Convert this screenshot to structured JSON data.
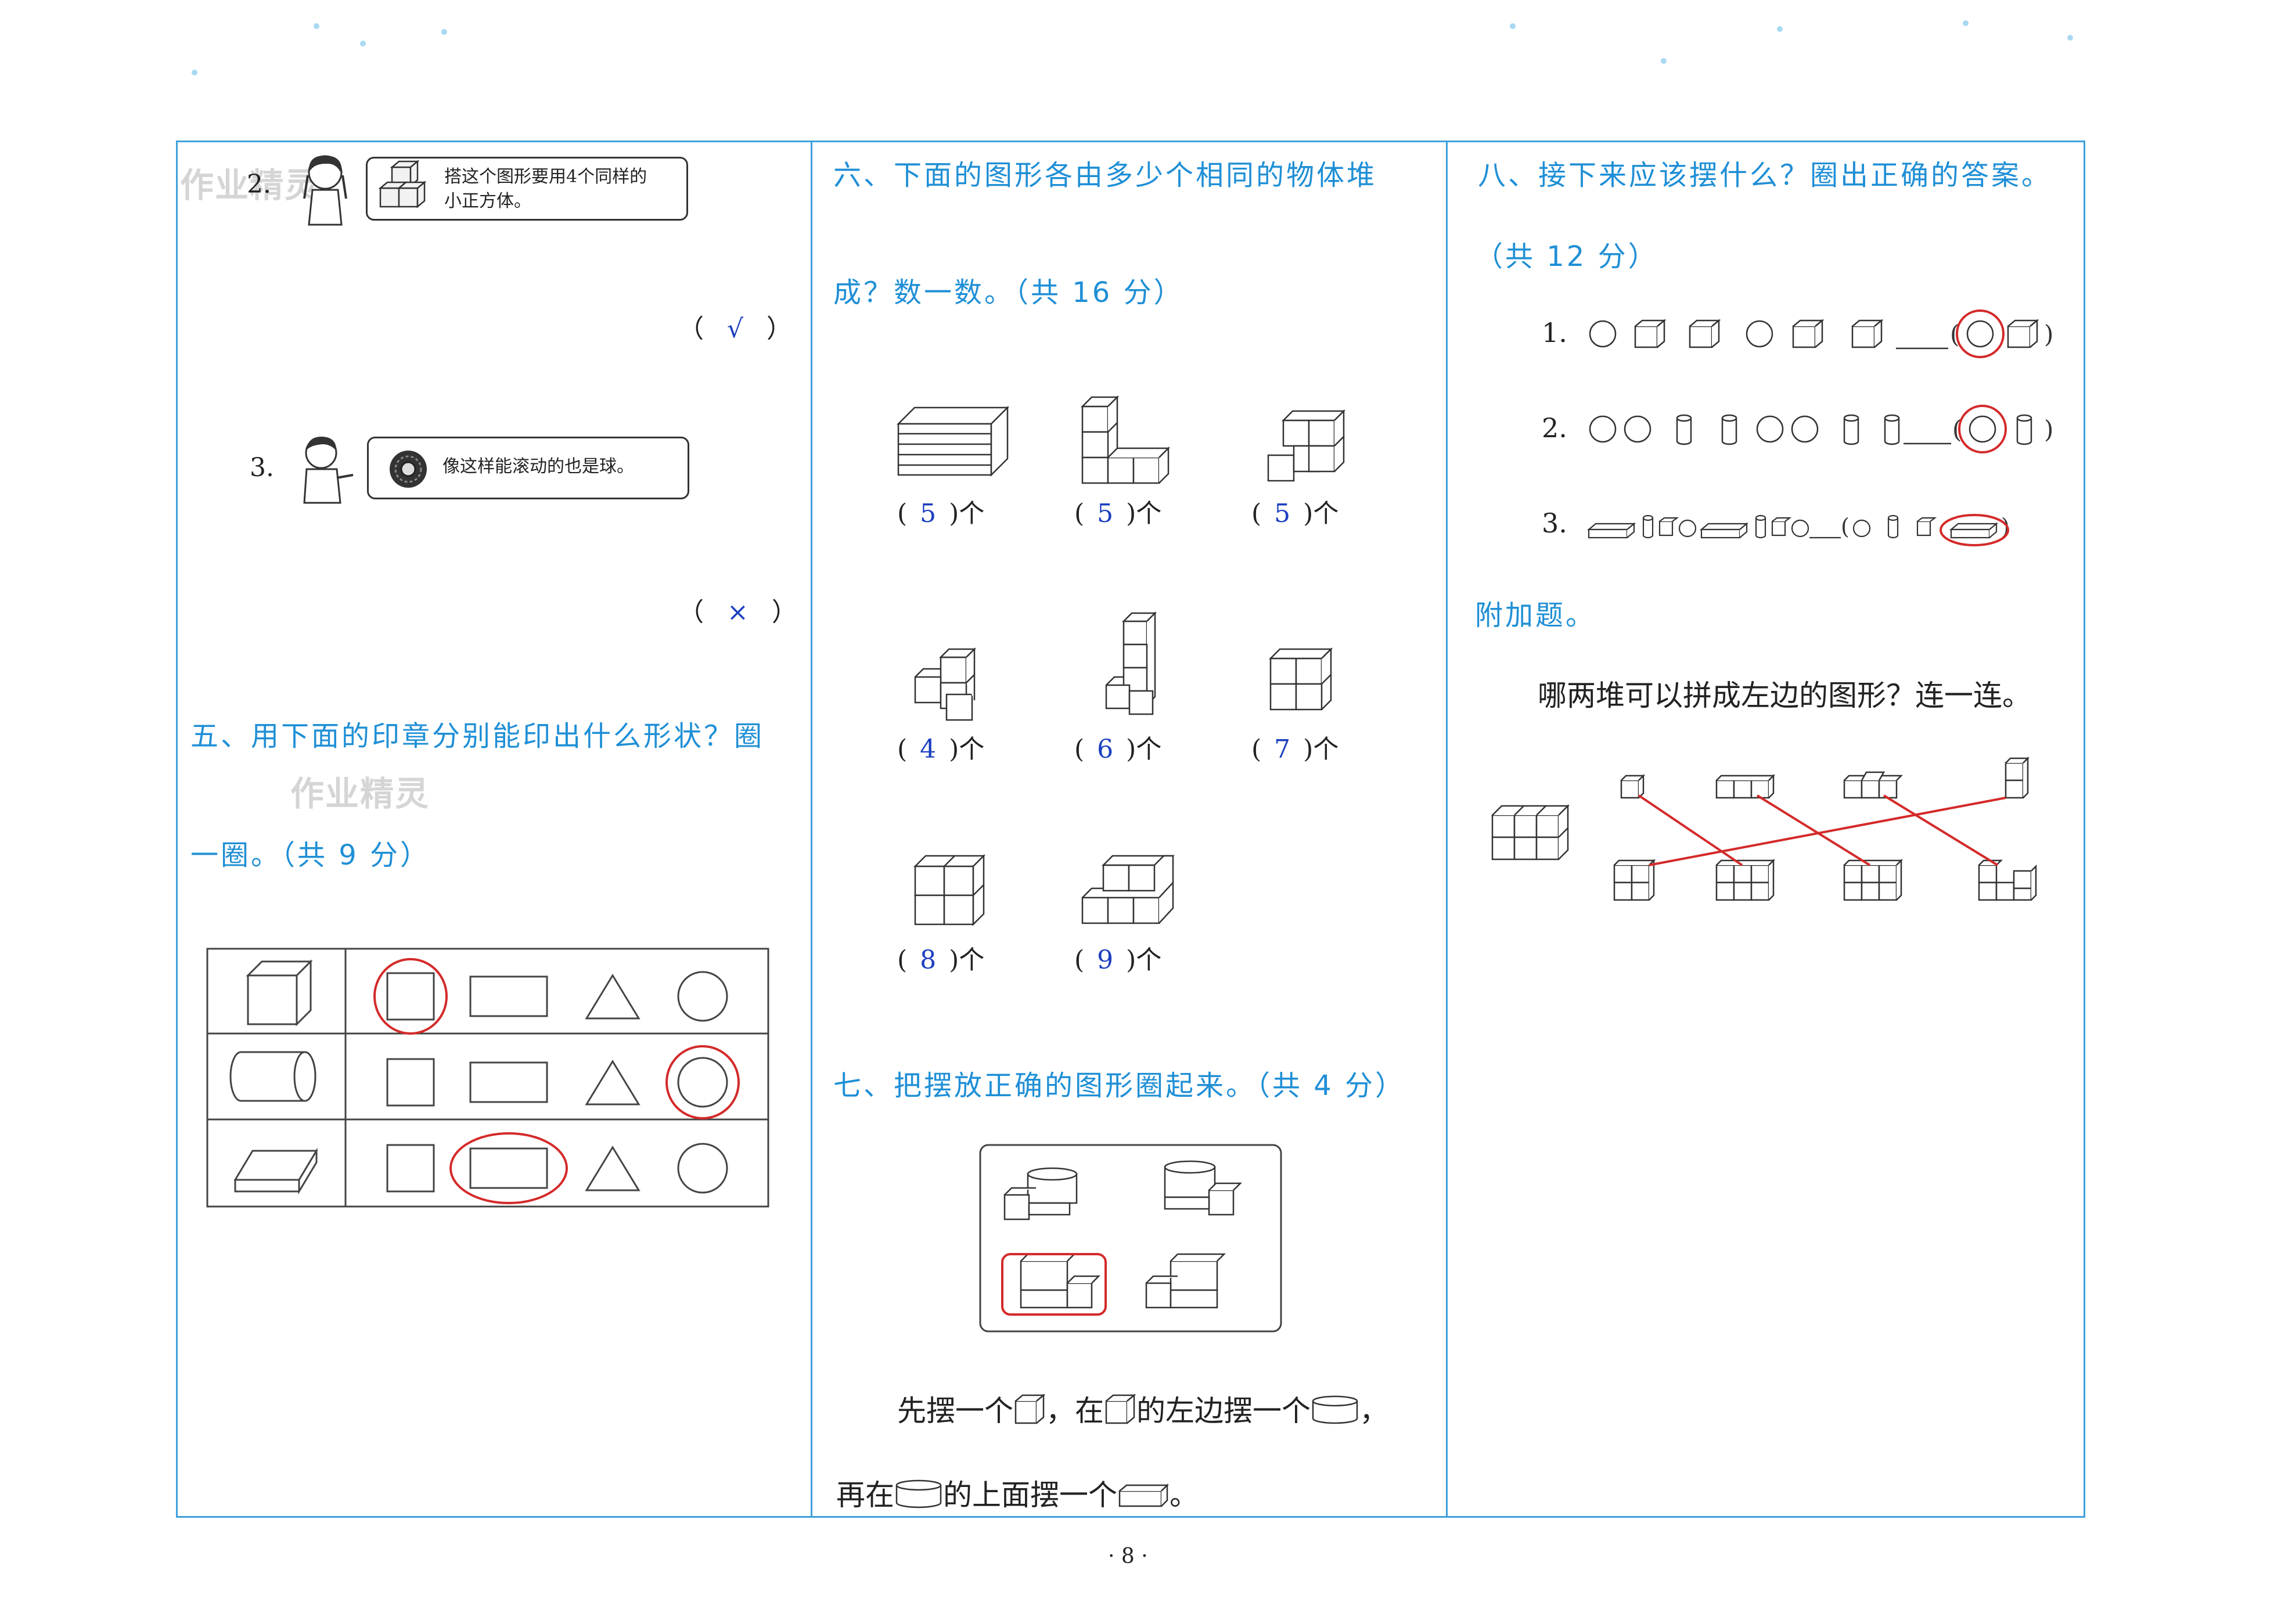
{
  "page_number": "· 8 ·",
  "watermark": "作业精灵",
  "left": {
    "q2": {
      "number": "2.",
      "bubble_line1": "搭这个图形要用4个同样的",
      "bubble_line2": "小正方体。",
      "answer_open": "（",
      "answer": "√",
      "answer_close": "）"
    },
    "q3": {
      "number": "3.",
      "bubble_text": "像这样能滚动的也是球。",
      "answer_open": "（",
      "answer": "×",
      "answer_close": "）"
    },
    "sec5": {
      "title_line1": "五、用下面的印章分别能印出什么形状？圈",
      "title_line2": "一圈。（共 9 分）"
    }
  },
  "middle": {
    "sec6": {
      "title_line1": "六、下面的图形各由多少个相同的物体堆",
      "title_line2": "成？数一数。（共 16 分）",
      "answers": [
        "5",
        "5",
        "5",
        "4",
        "6",
        "7",
        "8",
        "9"
      ],
      "unit": "个"
    },
    "sec7": {
      "title": "七、把摆放正确的图形圈起来。（共 4 分）",
      "line1_a": "先摆一个",
      "line1_b": "，在",
      "line1_c": "的左边摆一个",
      "line1_d": "，",
      "line2_a": "再在",
      "line2_b": "的上面摆一个",
      "line2_c": "。"
    }
  },
  "right": {
    "sec8": {
      "title_line1": "八、接下来应该摆什么？圈出正确的答案。",
      "title_line2": "（共 12 分）",
      "rows": [
        "1.",
        "2.",
        "3."
      ]
    },
    "bonus": {
      "title": "附加题。",
      "question": "哪两堆可以拼成左边的图形？连一连。"
    }
  },
  "colors": {
    "heading": "#1f8fd6",
    "frame": "#3fa0dc",
    "answer": "#1a3fbf",
    "circle": "#d42a2a"
  }
}
